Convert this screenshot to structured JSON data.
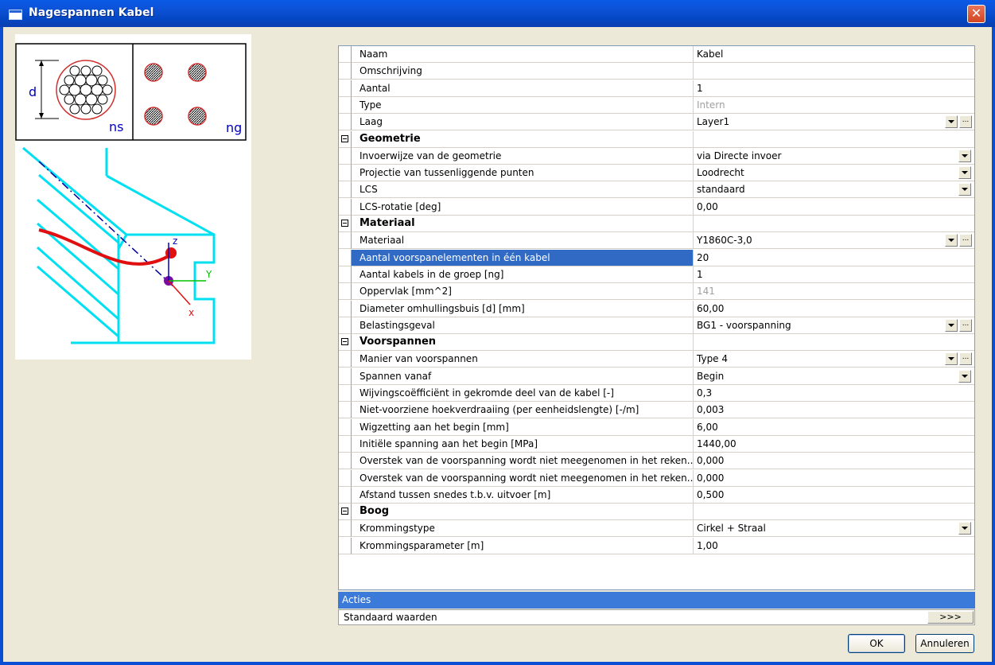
{
  "window": {
    "title": "Nagespannen Kabel",
    "close_label": "✕"
  },
  "preview": {
    "label_d": "d",
    "label_ns": "ns",
    "label_ng": "ng",
    "axis_z": "z",
    "axis_y": "Y",
    "axis_x": "x"
  },
  "properties": [
    {
      "label": "Naam",
      "value": "Kabel"
    },
    {
      "label": "Omschrijving",
      "value": ""
    },
    {
      "label": "Aantal",
      "value": "1"
    },
    {
      "label": "Type",
      "value": "Intern",
      "disabled": true
    },
    {
      "label": "Laag",
      "value": "Layer1",
      "dropdown": true,
      "ellipsis": true
    },
    {
      "label": "Geometrie",
      "category": true
    },
    {
      "label": "Invoerwijze van de geometrie",
      "value": "via Directe invoer",
      "dropdown": true
    },
    {
      "label": "Projectie van tussenliggende punten",
      "value": "Loodrecht",
      "dropdown": true
    },
    {
      "label": "LCS",
      "value": "standaard",
      "dropdown": true
    },
    {
      "label": "LCS-rotatie [deg]",
      "value": "0,00"
    },
    {
      "label": "Materiaal",
      "category": true
    },
    {
      "label": "Materiaal",
      "value": "Y1860C-3,0",
      "dropdown": true,
      "ellipsis": true
    },
    {
      "label": "Aantal voorspanelementen in één kabel",
      "value": "20",
      "selected": true
    },
    {
      "label": "Aantal kabels in de groep [ng]",
      "value": "1"
    },
    {
      "label": "Oppervlak [mm^2]",
      "value": "141",
      "disabled": true
    },
    {
      "label": "Diameter omhullingsbuis [d] [mm]",
      "value": "60,00"
    },
    {
      "label": "Belastingsgeval",
      "value": "BG1 - voorspanning",
      "dropdown": true,
      "ellipsis": true
    },
    {
      "label": "Voorspannen",
      "category": true
    },
    {
      "label": "Manier van voorspannen",
      "value": "Type 4",
      "dropdown": true,
      "ellipsis": true
    },
    {
      "label": "Spannen vanaf",
      "value": "Begin",
      "dropdown": true
    },
    {
      "label": "Wijvingscoëfficiënt in gekromde deel van de kabel [-]",
      "value": "0,3"
    },
    {
      "label": "Niet-voorziene hoekverdraaiing (per eenheidslengte) [-/m]",
      "value": "0,003"
    },
    {
      "label": "Wigzetting aan het begin [mm]",
      "value": "6,00"
    },
    {
      "label": "Initiële spanning aan het begin [MPa]",
      "value": "1440,00"
    },
    {
      "label": "Overstek van de voorspanning wordt niet meegenomen in het reken...",
      "value": "0,000"
    },
    {
      "label": "Overstek van de voorspanning wordt niet meegenomen in het reken...",
      "value": "0,000"
    },
    {
      "label": "Afstand tussen snedes t.b.v. uitvoer [m]",
      "value": "0,500"
    },
    {
      "label": "Boog",
      "category": true
    },
    {
      "label": "Krommingstype",
      "value": "Cirkel + Straal",
      "dropdown": true
    },
    {
      "label": "Krommingsparameter [m]",
      "value": "1,00"
    }
  ],
  "actions": {
    "header": "Acties",
    "item_label": "Standaard waarden",
    "item_button": ">>>"
  },
  "buttons": {
    "ok": "OK",
    "cancel": "Annuleren"
  }
}
